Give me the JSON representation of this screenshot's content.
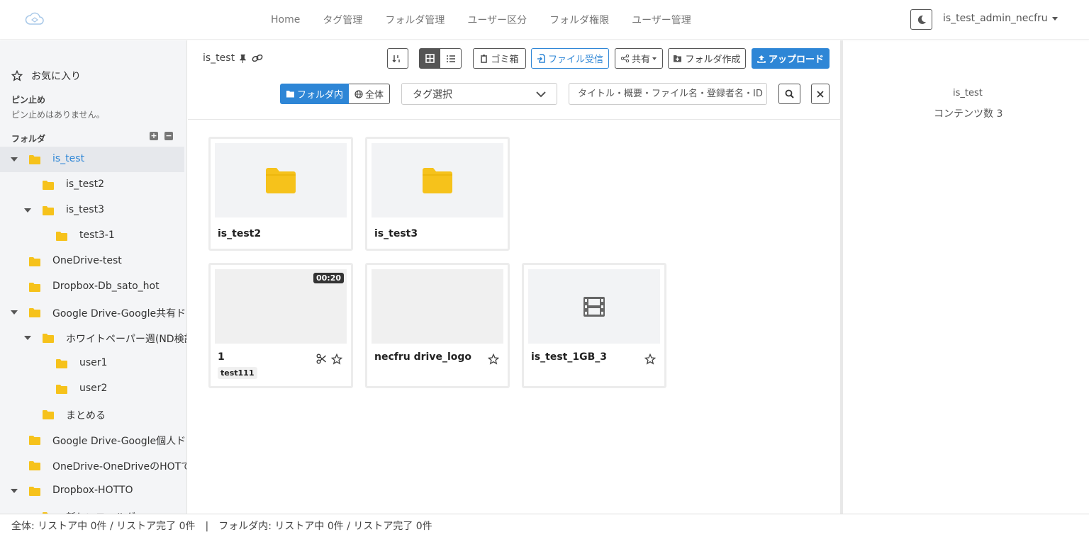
{
  "nav": {
    "links": [
      "Home",
      "タグ管理",
      "フォルダ管理",
      "ユーザー区分",
      "フォルダ権限",
      "ユーザー管理"
    ],
    "user": "is_test_admin_necfru"
  },
  "sidebar": {
    "favorites": "お気に入り",
    "pin_label": "ピン止め",
    "pin_empty": "ピン止めはありません。",
    "folder_label": "フォルダ",
    "tree": [
      {
        "label": "is_test",
        "active": true,
        "expanded": true
      },
      {
        "label": "is_test2"
      },
      {
        "label": "is_test3",
        "expanded": true
      },
      {
        "label": "test3-1"
      },
      {
        "label": "OneDrive-test"
      },
      {
        "label": "Dropbox-Db_sato_hot"
      },
      {
        "label": "Google Drive-Google共有ドライブ",
        "expanded": true
      },
      {
        "label": "ホワイトペーパー週(ND検討)",
        "expanded": true
      },
      {
        "label": "user1"
      },
      {
        "label": "user2"
      },
      {
        "label": "まとめる"
      },
      {
        "label": "Google Drive-Google個人ドライブ"
      },
      {
        "label": "OneDrive-OneDriveのHOTで"
      },
      {
        "label": "Dropbox-HOTTO",
        "expanded": true
      },
      {
        "label": "新しいフォルダー"
      }
    ]
  },
  "toolbar": {
    "breadcrumb": "is_test",
    "trash": "ゴミ箱",
    "receive": "ファイル受信",
    "share": "共有",
    "new_folder": "フォルダ作成",
    "upload": "アップロード",
    "scope_in_folder": "フォルダ内",
    "scope_all": "全体",
    "tag_select": "タグ選択",
    "search_placeholder": "タイトル・概要・ファイル名・登録者名・ID"
  },
  "cards": {
    "folders": [
      {
        "name": "is_test2"
      },
      {
        "name": "is_test3"
      }
    ],
    "files": [
      {
        "name": "1",
        "duration": "00:20",
        "tag": "test111"
      },
      {
        "name": "necfru drive_logo"
      },
      {
        "name": "is_test_1GB_3"
      }
    ]
  },
  "right_panel": {
    "title": "is_test",
    "count": "コンテンツ数 3"
  },
  "status": "全体: リストア中 0件 / リストア完了 0件　|　フォルダ内: リストア中 0件 / リストア完了 0件",
  "colors": {
    "accent": "#2e86d6",
    "folder": "#f6c21b"
  }
}
